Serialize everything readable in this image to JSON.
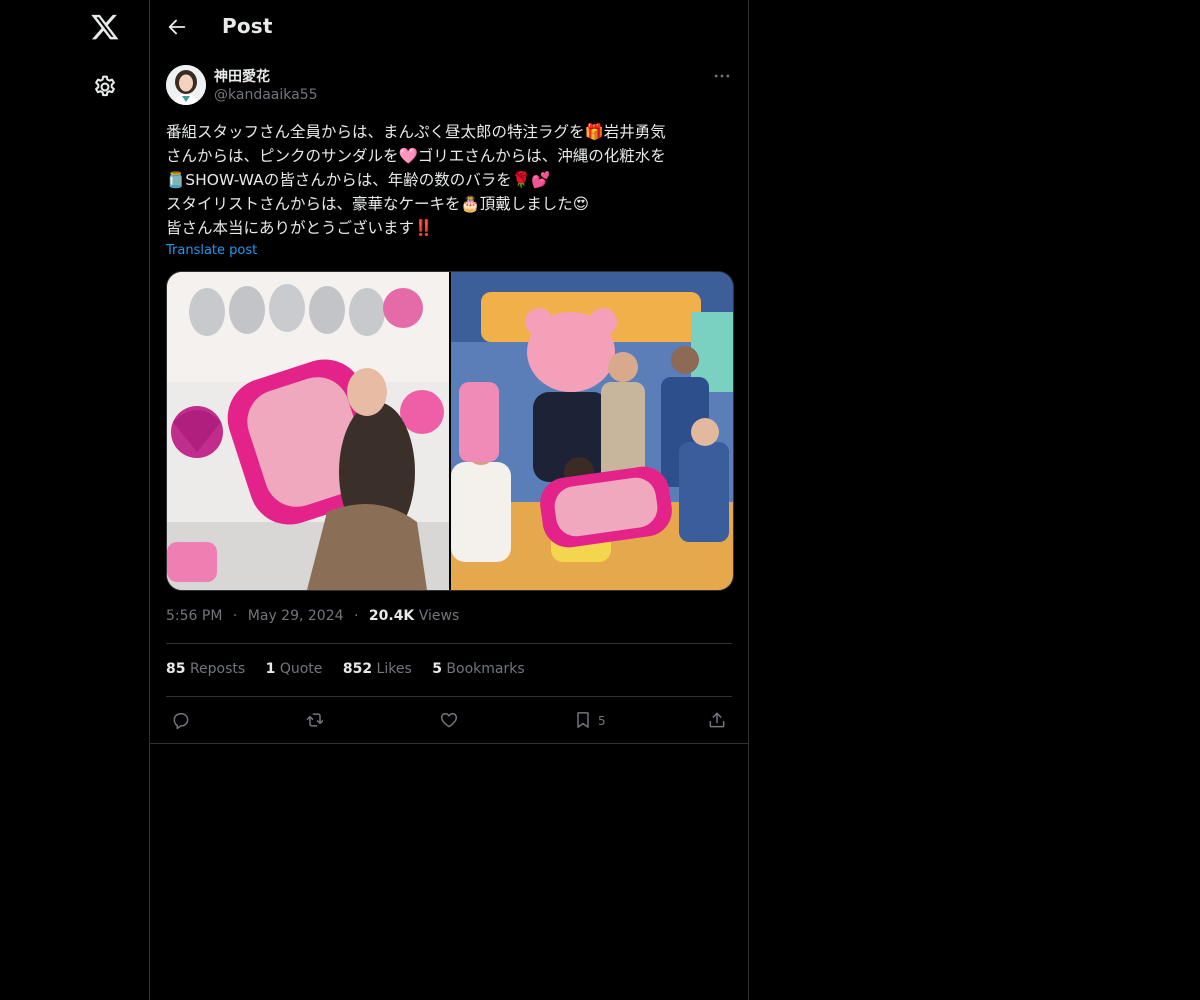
{
  "sidebar": {
    "logo_icon": "x-logo-icon",
    "settings_icon": "gear-icon"
  },
  "header": {
    "title": "Post",
    "back_icon": "arrow-left-icon"
  },
  "post": {
    "author": {
      "display_name": "神田愛花",
      "handle": "@kandaaika55"
    },
    "text_lines": [
      "番組スタッフさん全員からは、まんぷく昼太郎の特注ラグを🎁岩井勇気",
      "さんからは、ピンクのサンダルを🩷ゴリエさんからは、沖縄の化粧水を",
      "🫙SHOW-WAの皆さんからは、年齢の数のバラを🌹💕",
      "スタイリストさんからは、豪華なケーキを🎂頂戴しました😍",
      "皆さん本当にありがとうございます‼️"
    ],
    "translate_label": "Translate post",
    "time": "5:56 PM",
    "date": "May 29, 2024",
    "separator": "·",
    "views_count": "20.4K",
    "views_label": "Views",
    "stats": {
      "reposts_count": "85",
      "reposts_label": "Reposts",
      "quotes_count": "1",
      "quotes_label": "Quote",
      "likes_count": "852",
      "likes_label": "Likes",
      "bookmarks_count": "5",
      "bookmarks_label": "Bookmarks"
    },
    "actions": {
      "bookmark_count": "5"
    }
  },
  "colors": {
    "background": "#000000",
    "text": "#e7e9ea",
    "muted": "#71767b",
    "link": "#1d9bf0",
    "border": "#2f3336"
  }
}
